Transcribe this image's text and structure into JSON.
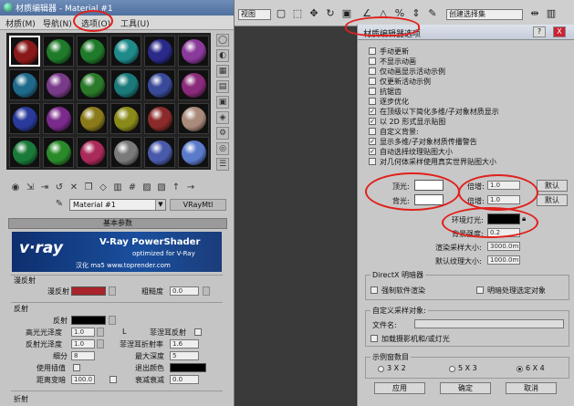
{
  "material_editor": {
    "title": "材质编辑器 - Material #1",
    "menu": [
      "材质(M)",
      "导航(N)",
      "选项(O)",
      "工具(U)"
    ],
    "material_name": "Material #1",
    "material_type": "VRayMtl",
    "rollouts": {
      "basic_params": "基本参数",
      "diffuse_group": "漫反射",
      "reflection_group": "反射",
      "refraction_group": "折射"
    },
    "banner": {
      "logo": "v·ray",
      "product": "V-Ray PowerShader",
      "subtitle": "optimized for V-Ray",
      "credit": "汉化 ma5 www.toprender.com"
    },
    "diffuse": {
      "label": "漫反射",
      "roughness_label": "粗糙度",
      "roughness_value": "0.0",
      "color": "#a8242a"
    },
    "reflection": {
      "label": "反射",
      "hilight_gloss_label": "高光光泽度",
      "hilight_gloss_value": "1.0",
      "lock": "L",
      "fresnel_label": "菲涅耳反射",
      "refl_gloss_label": "反射光泽度",
      "refl_gloss_value": "1.0",
      "fresnel_ior_label": "菲涅耳折射率",
      "fresnel_ior_value": "1.6",
      "subdivs_label": "细分",
      "subdivs_value": "8",
      "max_depth_label": "最大深度",
      "max_depth_value": "5",
      "use_interp_label": "使用插值",
      "exit_color_label": "退出颜色",
      "dim_dist_label": "距离变暗",
      "dim_dist_value": "100.0",
      "dim_falloff_label": "衰减衰减",
      "dim_falloff_value": "0.0",
      "color": "#000000",
      "exit_color": "#000000"
    },
    "slot_colors": [
      "#8a1a1a",
      "#1f7a2a",
      "#1f7a2a",
      "#1f8a8a",
      "#2a2a8a",
      "#8a3a9a",
      "#1f6a8a",
      "#7a3a8a",
      "#2a7a2a",
      "#1a7a7a",
      "#3a4a9a",
      "#8a2a7a",
      "#2a3a9a",
      "#7a2a8a",
      "#8a7a1a",
      "#8a8a1a",
      "#8a2a2a",
      "#aa8a7a",
      "#1a7a3a",
      "#2a8a2a",
      "#aa2a5a",
      "#7a7a7a",
      "#4a5aaa",
      "#5a7aca"
    ]
  },
  "toolbar": {
    "view_dropdown": "视图",
    "selection_set": "创建选择集"
  },
  "preferences": {
    "title": "材质编辑器选项",
    "help": "?",
    "close": "X",
    "options": [
      {
        "label": "手动更新",
        "checked": false
      },
      {
        "label": "不显示动画",
        "checked": false
      },
      {
        "label": "仅动画显示活动示例",
        "checked": false
      },
      {
        "label": "仅更新活动示例",
        "checked": false
      },
      {
        "label": "抗锯齿",
        "checked": false
      },
      {
        "label": "逐步优化",
        "checked": false
      },
      {
        "label": "在顶级以下简化多维/子对象材质显示",
        "checked": true
      },
      {
        "label": "以 2D 形式显示贴图",
        "checked": true
      },
      {
        "label": "自定义背景:",
        "checked": false
      },
      {
        "label": "显示多维/子对象材质传播警告",
        "checked": true
      },
      {
        "label": "自动选择纹理贴图大小",
        "checked": true
      },
      {
        "label": "对几何体采样使用真实世界贴图大小",
        "checked": false
      }
    ],
    "top_light_label": "顶光:",
    "back_light_label": "背光:",
    "top_light_color": "#ffffff",
    "back_light_color": "#ffffff",
    "multiplier_label": "倍增:",
    "multiplier_top": "1.0",
    "multiplier_back": "1.0",
    "default_label": "默认",
    "ambient_label": "环境灯光:",
    "ambient_color": "#000000",
    "bg_intensity_label": "背景强度:",
    "bg_intensity_value": "0.2",
    "render_sample_size_label": "渲染采样大小:",
    "render_sample_size_value": "3000.0m",
    "default_texture_size_label": "默认纹理大小:",
    "default_texture_size_value": "1000.0m",
    "directx_group": "DirectX 明暗器",
    "force_software": "强制软件渲染",
    "explicit_shading": "明暗处理选定对象",
    "custom_sample_group": "自定义采样对象:",
    "file_name_label": "文件名:",
    "load_camera": "加载摄影机和/或灯光",
    "slots_group": "示例窗数目",
    "slot_options": [
      "3 X 2",
      "5 X 3",
      "6 X 4"
    ],
    "selected_slot_option": "6 X 4",
    "apply": "应用",
    "ok": "确定",
    "cancel": "取消"
  },
  "accent_colors": {
    "annotation_red": "#e0201c",
    "title_blue": "#5a7aab"
  }
}
